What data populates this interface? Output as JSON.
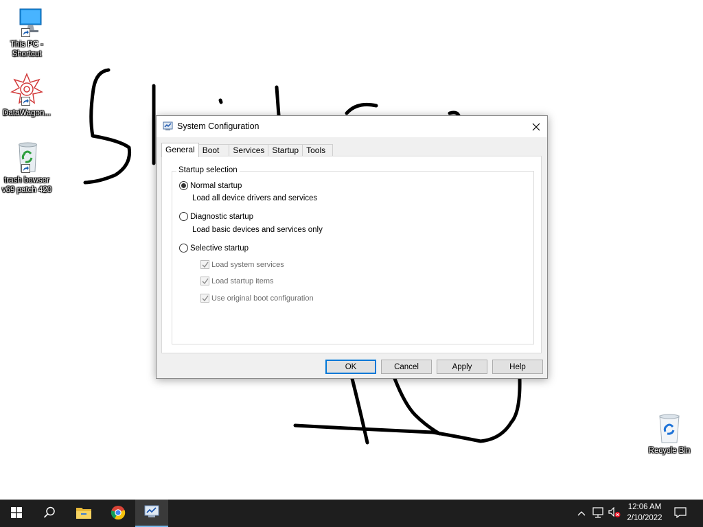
{
  "desktop": {
    "icons": [
      {
        "label_line1": "This PC -",
        "label_line2": "Shortcut",
        "icon": "computer-icon"
      },
      {
        "label_line1": "DataWagon...",
        "label_line2": "",
        "icon": "datawagon-icon"
      },
      {
        "label_line1": "trash bowser",
        "label_line2": "v69 patch 420",
        "icon": "recycle-full-icon"
      }
    ],
    "recycle_bin": {
      "label": "Recycle Bin",
      "icon": "recycle-bin-icon"
    }
  },
  "dialog": {
    "title": "System Configuration",
    "tabs": [
      {
        "label": "General",
        "active": true
      },
      {
        "label": "Boot",
        "active": false
      },
      {
        "label": "Services",
        "active": false
      },
      {
        "label": "Startup",
        "active": false
      },
      {
        "label": "Tools",
        "active": false
      }
    ],
    "group_label": "Startup selection",
    "options": [
      {
        "label": "Normal startup",
        "description": "Load all device drivers and services",
        "checked": true
      },
      {
        "label": "Diagnostic startup",
        "description": "Load basic devices and services only",
        "checked": false
      },
      {
        "label": "Selective startup",
        "description": "",
        "checked": false
      }
    ],
    "selective_items": [
      {
        "label": "Load system services",
        "checked": true,
        "enabled": false
      },
      {
        "label": "Load startup items",
        "checked": true,
        "enabled": false
      },
      {
        "label": "Use original boot configuration",
        "checked": true,
        "enabled": false
      }
    ],
    "buttons": {
      "ok": "OK",
      "cancel": "Cancel",
      "apply": "Apply",
      "help": "Help"
    }
  },
  "taskbar": {
    "time": "12:06 AM",
    "date": "2/10/2022",
    "accent": "#76b9ed",
    "pinned": [
      "windows-start-icon",
      "search-icon",
      "file-explorer-icon",
      "chrome-icon",
      "msconfig-icon"
    ]
  }
}
